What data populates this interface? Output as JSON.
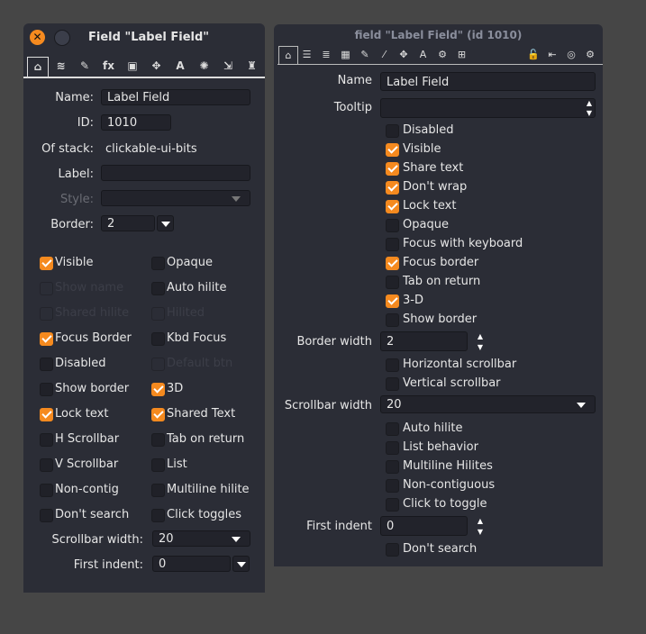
{
  "left": {
    "title": "Field \"Label Field\"",
    "tabs": [
      "home-icon",
      "stack-icon",
      "pencil-icon",
      "fx-icon",
      "image-icon",
      "move-icon",
      "text-icon",
      "effects-icon",
      "resize-icon",
      "script-icon"
    ],
    "tab_glyphs": [
      "⌂",
      "≋",
      "✎",
      "fx",
      "▣",
      "✥",
      "A",
      "✺",
      "⇲",
      "♜"
    ],
    "name_label": "Name:",
    "name_value": "Label Field",
    "id_label": "ID:",
    "id_value": "1010",
    "stack_label": "Of stack:",
    "stack_value": "clickable-ui-bits",
    "label_label": "Label:",
    "label_value": "",
    "style_label": "Style:",
    "style_value": "",
    "border_label": "Border:",
    "border_value": "2",
    "checks": [
      [
        {
          "label": "Visible",
          "checked": true
        },
        {
          "label": "Opaque",
          "checked": false
        }
      ],
      [
        {
          "label": "Show name",
          "checked": false,
          "disabled": true
        },
        {
          "label": "Auto hilite",
          "checked": false
        }
      ],
      [
        {
          "label": "Shared hilite",
          "checked": false,
          "disabled": true
        },
        {
          "label": "Hilited",
          "checked": false,
          "disabled": true
        }
      ],
      [
        {
          "label": "Focus Border",
          "checked": true
        },
        {
          "label": "Kbd Focus",
          "checked": false
        }
      ],
      [
        {
          "label": "Disabled",
          "checked": false
        },
        {
          "label": "Default btn",
          "checked": false,
          "disabled": true
        }
      ],
      [
        {
          "label": "Show border",
          "checked": false
        },
        {
          "label": "3D",
          "checked": true
        }
      ],
      [
        {
          "label": "Lock text",
          "checked": true
        },
        {
          "label": "Shared Text",
          "checked": true
        }
      ],
      [
        {
          "label": "H Scrollbar",
          "checked": false
        },
        {
          "label": "Tab on return",
          "checked": false
        }
      ],
      [
        {
          "label": "V Scrollbar",
          "checked": false
        },
        {
          "label": "List",
          "checked": false
        }
      ],
      [
        {
          "label": "Non-contig",
          "checked": false
        },
        {
          "label": "Multiline hilite",
          "checked": false
        }
      ],
      [
        {
          "label": "Don't search",
          "checked": false
        },
        {
          "label": "Click toggles",
          "checked": false
        }
      ]
    ],
    "scrollbar_label": "Scrollbar width:",
    "scrollbar_value": "20",
    "indent_label": "First indent:",
    "indent_value": "0"
  },
  "right": {
    "title": "field \"Label Field\" (id 1010)",
    "tabs": [
      "home-icon",
      "list-icon",
      "database-icon",
      "table-icon",
      "pencil-icon",
      "wand-icon",
      "move-icon",
      "text-icon",
      "gears-icon",
      "layout-icon"
    ],
    "tab_glyphs": [
      "⌂",
      "☰",
      "≣",
      "▦",
      "✎",
      "⁄",
      "✥",
      "A",
      "⚙",
      "⊞"
    ],
    "right_tabs": [
      "unlock-icon",
      "import-icon",
      "target-icon",
      "settings-icon"
    ],
    "right_glyphs": [
      "🔓",
      "⇤",
      "◎",
      "⚙"
    ],
    "name_label": "Name",
    "name_value": "Label Field",
    "tooltip_label": "Tooltip",
    "tooltip_value": "",
    "checks1": [
      {
        "label": "Disabled",
        "checked": false
      },
      {
        "label": "Visible",
        "checked": true
      },
      {
        "label": "Share text",
        "checked": true
      },
      {
        "label": "Don't wrap",
        "checked": true
      },
      {
        "label": "Lock text",
        "checked": true
      },
      {
        "label": "Opaque",
        "checked": false
      },
      {
        "label": "Focus with keyboard",
        "checked": false
      },
      {
        "label": "Focus border",
        "checked": true
      },
      {
        "label": "Tab on return",
        "checked": false
      },
      {
        "label": "3-D",
        "checked": true
      },
      {
        "label": "Show border",
        "checked": false
      }
    ],
    "border_label": "Border width",
    "border_value": "2",
    "checks2": [
      {
        "label": "Horizontal scrollbar",
        "checked": false
      },
      {
        "label": "Vertical scrollbar",
        "checked": false
      }
    ],
    "scrollbar_label": "Scrollbar width",
    "scrollbar_value": "20",
    "checks3": [
      {
        "label": "Auto hilite",
        "checked": false
      },
      {
        "label": "List behavior",
        "checked": false
      },
      {
        "label": "Multiline Hilites",
        "checked": false
      },
      {
        "label": "Non-contiguous",
        "checked": false
      },
      {
        "label": "Click to toggle",
        "checked": false
      }
    ],
    "indent_label": "First indent",
    "indent_value": "0",
    "checks4": [
      {
        "label": "Don't search",
        "checked": false
      }
    ]
  },
  "colors": {
    "accent": "#f58a1f",
    "panel": "#2b2d36",
    "background": "#464646"
  }
}
